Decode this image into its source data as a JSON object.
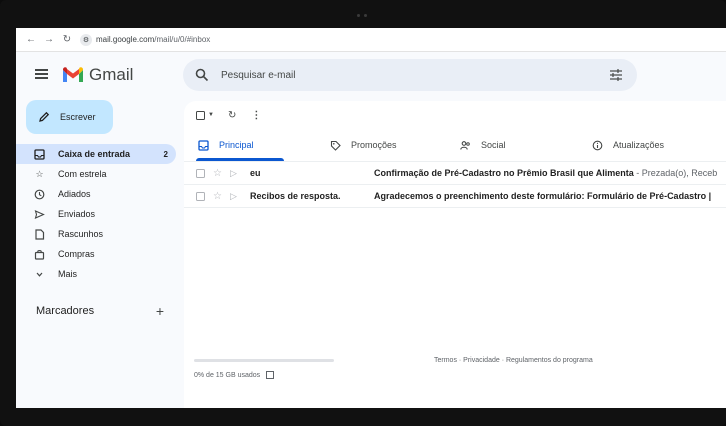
{
  "browser": {
    "url_host": "mail.google.com",
    "url_path": "/mail/u/0/#inbox"
  },
  "app": {
    "name": "Gmail",
    "search_placeholder": "Pesquisar e-mail",
    "compose_label": "Escrever"
  },
  "sidebar": {
    "items": [
      {
        "label": "Caixa de entrada",
        "icon": "inbox-icon",
        "count": "2",
        "active": true
      },
      {
        "label": "Com estrela",
        "icon": "star-icon"
      },
      {
        "label": "Adiados",
        "icon": "clock-icon"
      },
      {
        "label": "Enviados",
        "icon": "send-icon"
      },
      {
        "label": "Rascunhos",
        "icon": "draft-icon"
      },
      {
        "label": "Compras",
        "icon": "shopping-bag-icon"
      },
      {
        "label": "Mais",
        "icon": "chevron-down-icon"
      }
    ],
    "labels_heading": "Marcadores"
  },
  "tabs": [
    {
      "label": "Principal",
      "icon": "inbox-icon",
      "active": true
    },
    {
      "label": "Promoções",
      "icon": "tag-icon"
    },
    {
      "label": "Social",
      "icon": "people-icon"
    },
    {
      "label": "Atualizações",
      "icon": "info-icon"
    }
  ],
  "emails": [
    {
      "sender": "eu",
      "subject": "Confirmação de Pré-Cadastro no Prêmio Brasil que Alimenta",
      "snippet": " - Prezada(o), Receb"
    },
    {
      "sender": "Recibos de resposta.",
      "subject": "Agradecemos o preenchimento deste formulário: Formulário de Pré-Cadastro |",
      "snippet": ""
    }
  ],
  "storage": {
    "text": "0% de 15 GB usados",
    "used_fraction": 0.0
  },
  "footer": {
    "text": "Termos · Privacidade · Regulamentos do programa"
  },
  "colors": {
    "accent": "#0b57d0",
    "compose_bg": "#c2e7ff",
    "active_item_bg": "#d3e3fd",
    "search_bg": "#e9eef6"
  }
}
